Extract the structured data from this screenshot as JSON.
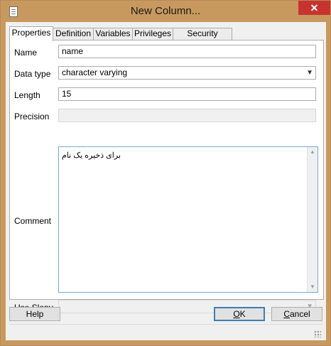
{
  "window": {
    "title": "New Column...",
    "close_label": "✕"
  },
  "tabs": [
    {
      "label": "Properties"
    },
    {
      "label": "Definition"
    },
    {
      "label": "Variables"
    },
    {
      "label": "Privileges"
    },
    {
      "label": "Security Labels"
    }
  ],
  "fields": {
    "name": {
      "label": "Name",
      "value": "name"
    },
    "data_type": {
      "label": "Data type",
      "value": "character varying"
    },
    "length": {
      "label": "Length",
      "value": "15"
    },
    "precision": {
      "label": "Precision",
      "value": ""
    },
    "comment": {
      "label": "Comment",
      "value": "برای ذخیره یک نام"
    },
    "use_slony": {
      "label": "Use Slony",
      "value": ""
    }
  },
  "buttons": {
    "help": "Help",
    "ok_prefix": "",
    "ok_mnemonic": "O",
    "ok_rest": "K",
    "cancel_mnemonic": "C",
    "cancel_rest": "ancel"
  },
  "icons": {
    "app": "document-icon",
    "dropdown": "chevron-down-icon",
    "scroll_up": "arrow-up-icon",
    "scroll_down": "arrow-down-icon",
    "grip": "resize-grip-icon"
  },
  "colors": {
    "titlebar": "#c8995f",
    "close": "#c7342f",
    "focus_border": "#7aa7d6"
  }
}
